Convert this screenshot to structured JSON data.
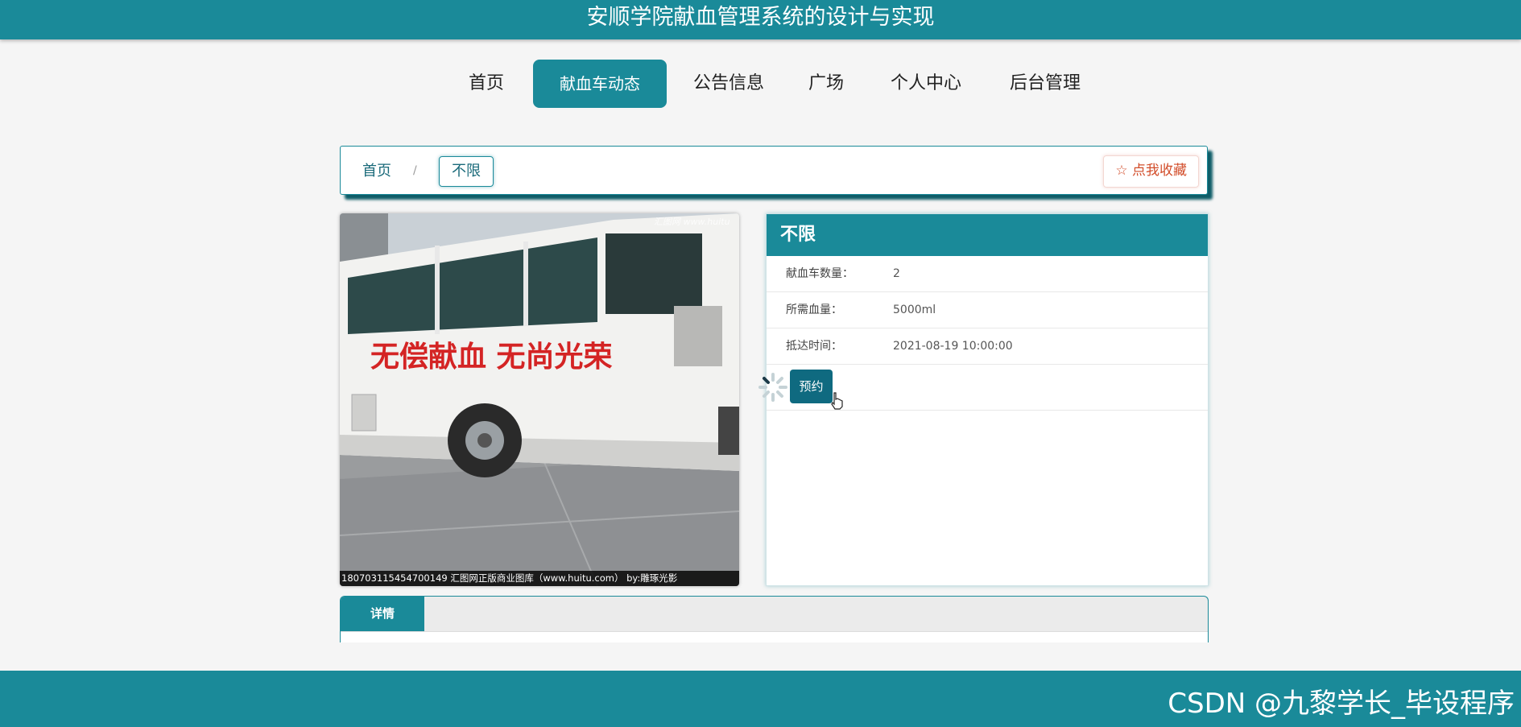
{
  "header": {
    "title": "安顺学院献血管理系统的设计与实现"
  },
  "nav": {
    "items": [
      {
        "label": "首页"
      },
      {
        "label": "献血车动态"
      },
      {
        "label": "公告信息"
      },
      {
        "label": "广场"
      },
      {
        "label": "个人中心"
      },
      {
        "label": "后台管理"
      }
    ]
  },
  "breadcrumb": {
    "home": "首页",
    "separator": "/",
    "current": "不限"
  },
  "favorite": {
    "label": "☆ 点我收藏"
  },
  "photo": {
    "caption": "180703115454700149 汇图网正版商业图库（www.huitu.com） by:雕琢光影",
    "bus_slogan": "无偿献血   无尚光荣",
    "site_watermark": "汇图网 www.huitu"
  },
  "info": {
    "title": "不限",
    "rows": [
      {
        "label": "献血车数量：",
        "value": "2"
      },
      {
        "label": "所需血量：",
        "value": "5000ml"
      },
      {
        "label": "抵达时间：",
        "value": "2021-08-19 10:00:00"
      }
    ],
    "reserve_label": "预约"
  },
  "tabs": {
    "active": "详情"
  },
  "watermark": "CSDN @九黎学长_毕设程序",
  "colors": {
    "primary": "#1a8a99",
    "danger": "#d24d2a",
    "button_dark": "#0f6a80"
  }
}
